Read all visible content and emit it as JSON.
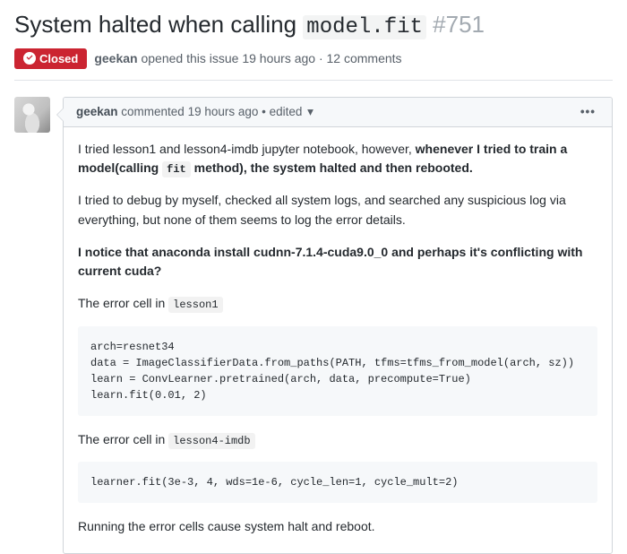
{
  "issue": {
    "title_before": "System halted when calling ",
    "title_code": "model.fit",
    "number": "#751",
    "state_label": "Closed",
    "author": "geekan",
    "opened_text": " opened this issue 19 hours ago · 12 comments"
  },
  "comment": {
    "author": "geekan",
    "header_text": " commented 19 hours ago • edited ",
    "caret": "▾",
    "kebab": "•••",
    "p1_a": "I tried lesson1 and lesson4-imdb jupyter notebook, however, ",
    "p1_b_strong": "whenever I tried to train a model(calling ",
    "p1_code": "fit",
    "p1_c_strong": " method), the system halted and then rebooted.",
    "p2": "I tried to debug by myself, checked all system logs, and searched any suspicious log via everything, but none of them seems to log the error details.",
    "p3_strong": "I notice that anaconda install cudnn-7.1.4-cuda9.0_0 and perhaps it's conflicting with current cuda?",
    "cell1_label_a": "The error cell in ",
    "cell1_label_code": "lesson1",
    "code1": "arch=resnet34\ndata = ImageClassifierData.from_paths(PATH, tfms=tfms_from_model(arch, sz))\nlearn = ConvLearner.pretrained(arch, data, precompute=True)\nlearn.fit(0.01, 2)",
    "cell2_label_a": "The error cell in ",
    "cell2_label_code": "lesson4-imdb",
    "code2": "learner.fit(3e-3, 4, wds=1e-6, cycle_len=1, cycle_mult=2)",
    "p_end": "Running the error cells cause system halt and reboot."
  }
}
